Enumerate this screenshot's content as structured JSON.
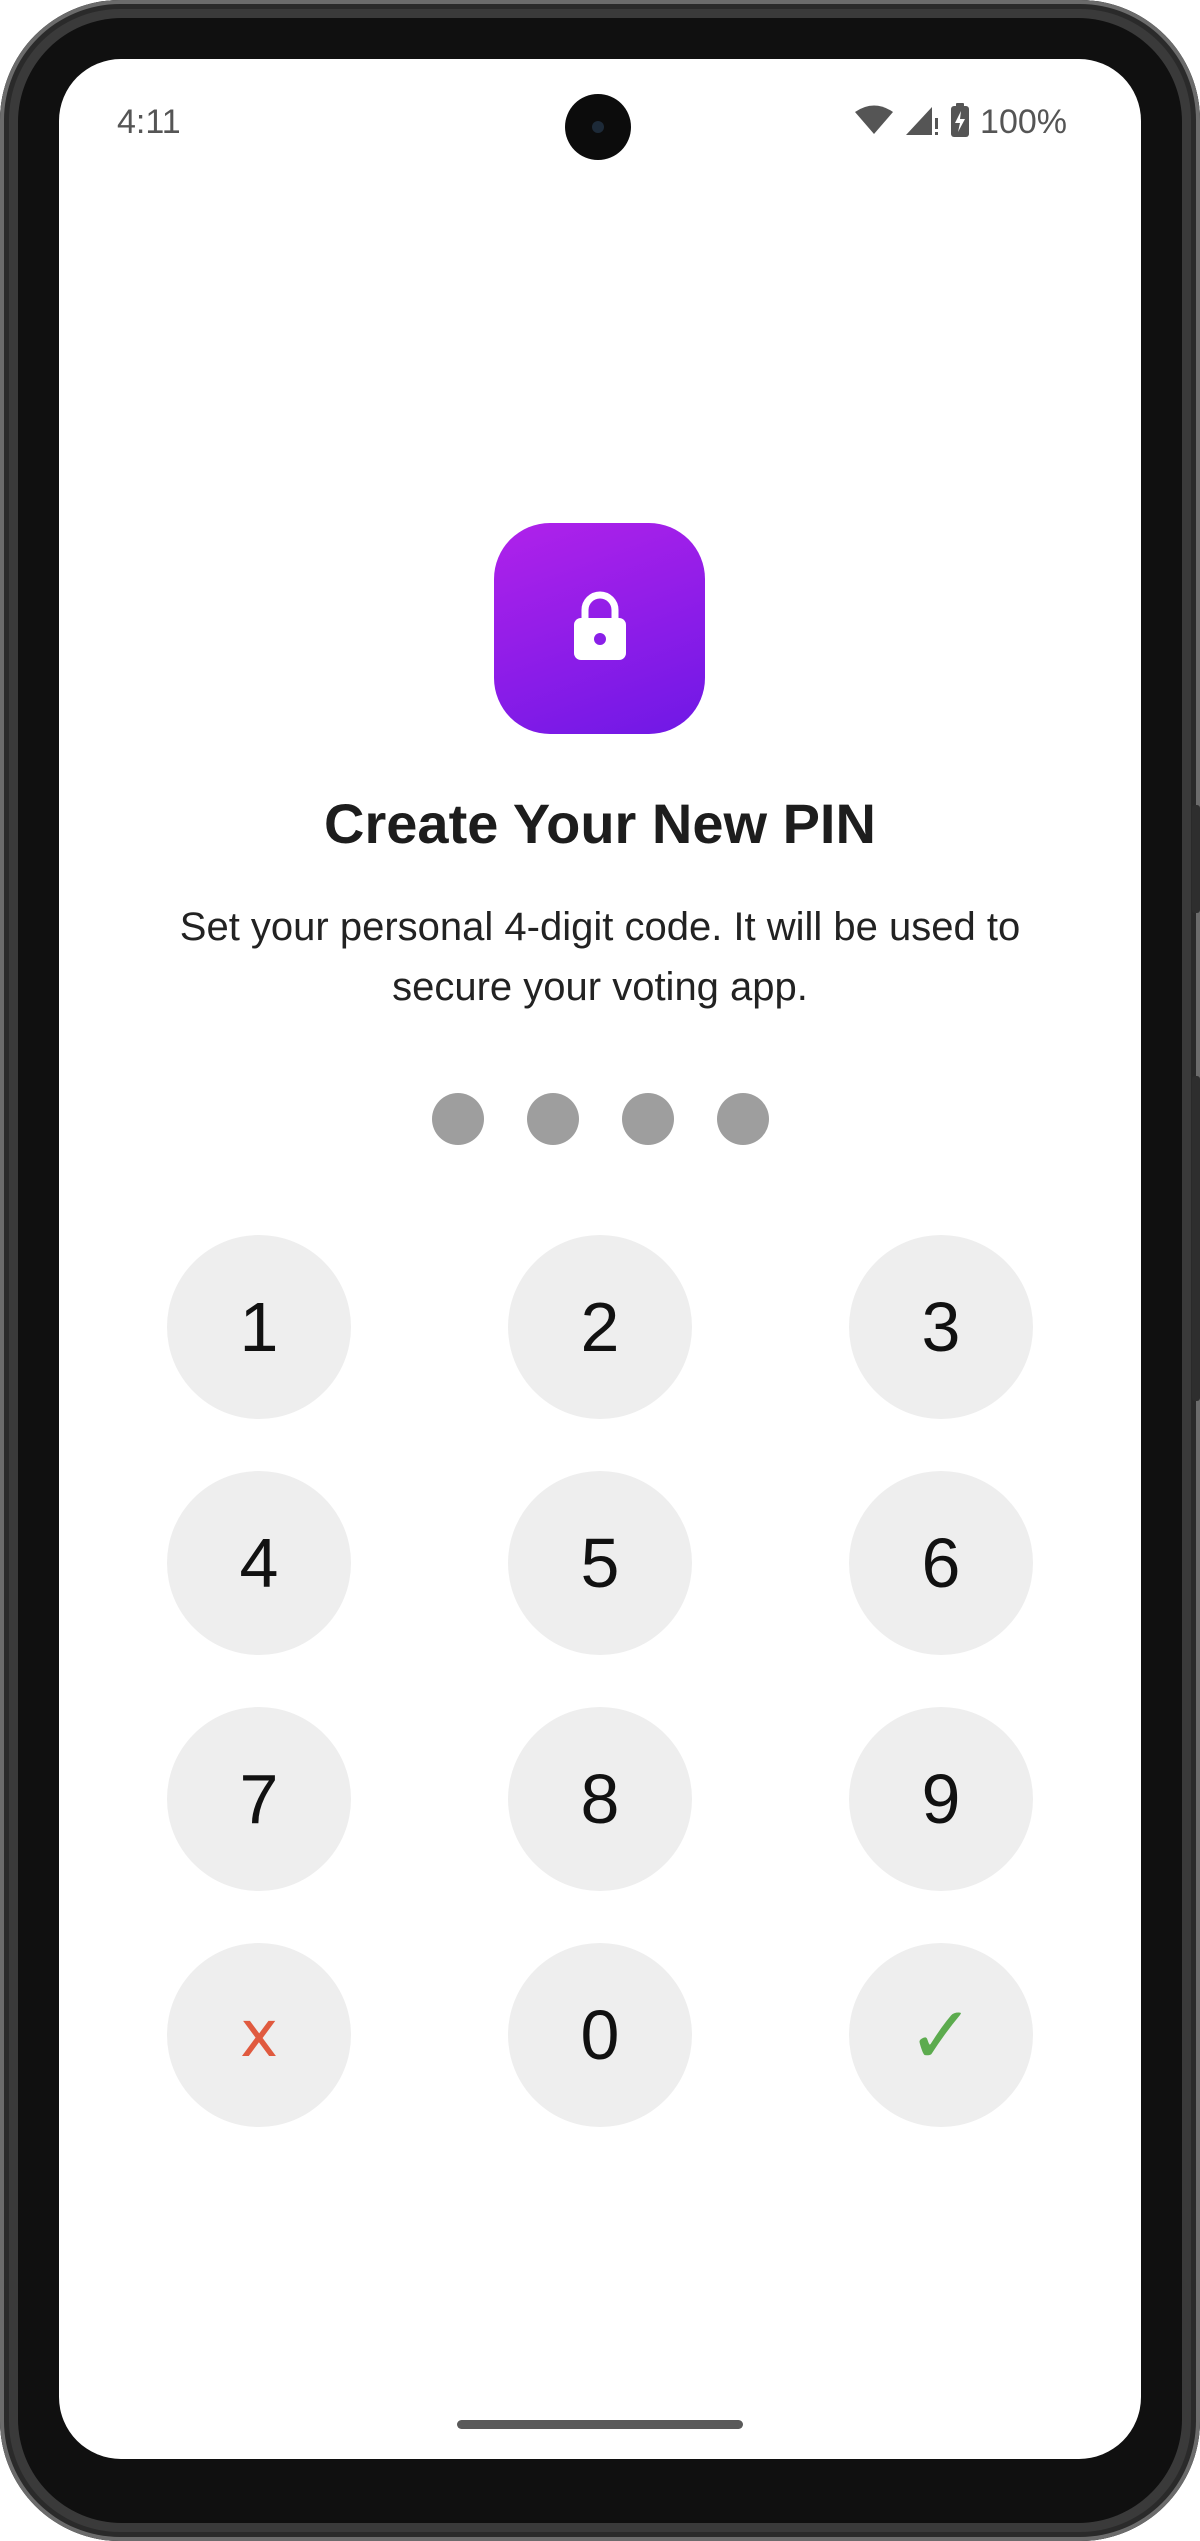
{
  "status_bar": {
    "time": "4:11",
    "battery_percent": "100%",
    "icons": [
      "wifi-icon",
      "signal-icon",
      "battery-charging-icon"
    ]
  },
  "header": {
    "icon": "lock-icon",
    "title": "Create Your New PIN",
    "subtitle": "Set your personal 4-digit code. It will be used to secure your voting app."
  },
  "pin": {
    "length": 4,
    "entered": 0
  },
  "keypad": {
    "keys": [
      "1",
      "2",
      "3",
      "4",
      "5",
      "6",
      "7",
      "8",
      "9"
    ],
    "clear_label": "x",
    "zero_label": "0",
    "confirm_label": "✓"
  },
  "colors": {
    "accent_start": "#b022ea",
    "accent_end": "#6f18e6",
    "key_background": "#eeeeee",
    "pin_dot": "#9e9e9e",
    "clear": "#e05a3f",
    "confirm": "#5cab4e"
  }
}
